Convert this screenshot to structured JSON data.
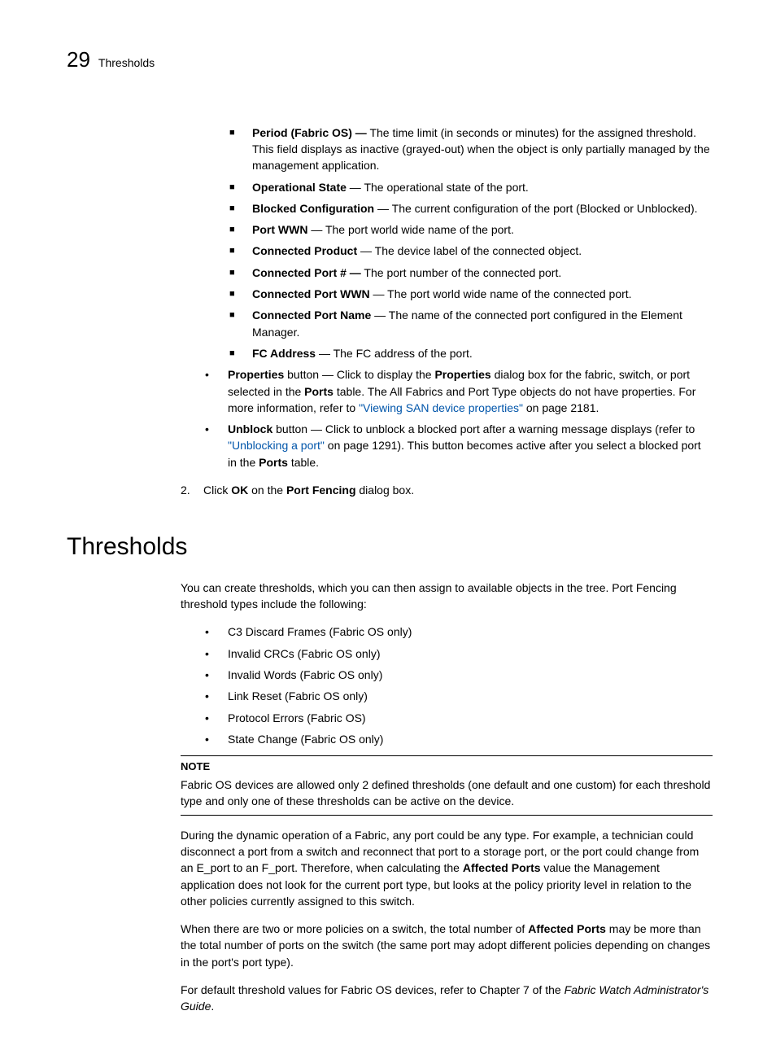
{
  "header": {
    "chapter": "29",
    "section": "Thresholds"
  },
  "defs": [
    {
      "term": "Period (Fabric OS) —",
      "desc": " The time limit (in seconds or minutes) for the assigned threshold. This field displays as inactive (grayed-out) when the object is only partially managed by the management application."
    },
    {
      "term": "Operational State",
      "desc": " — The operational state of the port."
    },
    {
      "term": "Blocked Configuration",
      "desc": " — The current configuration of the port (Blocked or Unblocked)."
    },
    {
      "term": "Port WWN",
      "desc": " — The port world wide name of the port."
    },
    {
      "term": "Connected Product",
      "desc": " — The device label of the connected object."
    },
    {
      "term": "Connected Port # —",
      "desc": " The port number of the connected port."
    },
    {
      "term": "Connected Port WWN",
      "desc": " — The port world wide name of the connected port."
    },
    {
      "term": "Connected Port Name",
      "desc": " — The name of the connected port configured in the Element Manager."
    },
    {
      "term": "FC Address",
      "desc": " — The FC address of the port."
    }
  ],
  "bullets": {
    "properties": {
      "b1": "Properties",
      "t1": " button — Click to display the ",
      "b2": "Properties",
      "t2": " dialog box for the fabric, switch, or port selected in the ",
      "b3": "Ports",
      "t3": " table. The All Fabrics and Port Type objects do not have properties. For more information, refer to ",
      "link": "\"Viewing SAN device properties\"",
      "t4": " on page 2181."
    },
    "unblock": {
      "b1": "Unblock",
      "t1": " button — Click to unblock a blocked port after a warning message displays (refer to ",
      "link": "\"Unblocking a port\"",
      "t2": " on page 1291). This button becomes active after you select a blocked port in the ",
      "b2": "Ports",
      "t3": " table."
    }
  },
  "step2": {
    "num": "2.",
    "t1": "Click ",
    "b1": "OK",
    "t2": " on the ",
    "b2": "Port Fencing",
    "t3": " dialog box."
  },
  "title": "Thresholds",
  "intro": "You can create thresholds, which you can then assign to available objects in the tree. Port Fencing threshold types include the following:",
  "types": [
    "C3 Discard Frames (Fabric OS only)",
    "Invalid CRCs (Fabric OS only)",
    "Invalid Words (Fabric OS only)",
    "Link Reset (Fabric OS only)",
    "Protocol Errors (Fabric OS)",
    "State Change (Fabric OS only)"
  ],
  "note": {
    "label": "NOTE",
    "text": "Fabric OS devices are allowed only 2 defined thresholds (one default and one custom) for each threshold type and only one of these thresholds can be active on the device."
  },
  "para1": {
    "t1": "During the dynamic operation of a Fabric, any port could be any type. For example, a technician could disconnect a port from a switch and reconnect that port to a storage port, or the port could change from an E_port to an F_port. Therefore, when calculating the ",
    "b1": "Affected Ports",
    "t2": " value the Management application does not look for the current port type, but looks at the policy priority level in relation to the other policies currently assigned to this switch."
  },
  "para2": {
    "t1": "When there are two or more policies on a switch, the total number of ",
    "b1": "Affected Ports",
    "t2": " may be more than the total number of ports on the switch (the same port may adopt different policies depending on changes in the port's port type)."
  },
  "para3": {
    "t1": "For default threshold values for Fabric OS devices, refer to Chapter 7 of the ",
    "i1": "Fabric Watch Administrator's Guide",
    "t2": "."
  }
}
